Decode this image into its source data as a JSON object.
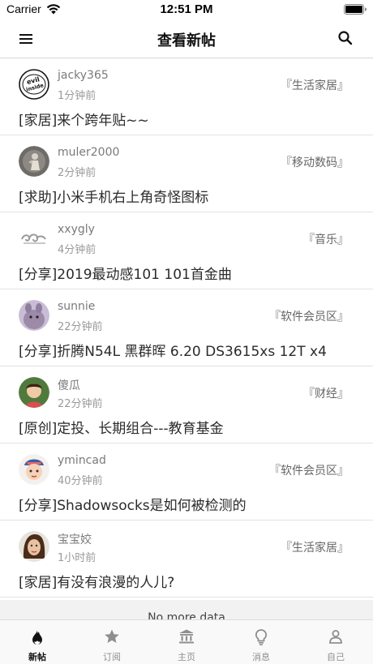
{
  "status_bar": {
    "carrier": "Carrier",
    "time": "12:51 PM"
  },
  "nav": {
    "title": "查看新帖"
  },
  "posts": [
    {
      "username": "jacky365",
      "time": "1分钟前",
      "forum": "『生活家居』",
      "title": "[家居]来个跨年贴~~",
      "avatar": "evil-inside-logo"
    },
    {
      "username": "muler2000",
      "time": "2分钟前",
      "forum": "『移动数码』",
      "title": "[求助]小米手机右上角奇怪图标",
      "avatar": "photo-figure"
    },
    {
      "username": "xxygly",
      "time": "4分钟前",
      "forum": "『音乐』",
      "title": "[分享]2019最动感101 101首金曲",
      "avatar": "cloud-swirl"
    },
    {
      "username": "sunnie",
      "time": "22分钟前",
      "forum": "『软件会员区』",
      "title": "[分享]折腾N54L 黑群晖 6.20 DS3615xs 12T x4",
      "avatar": "purple-plush"
    },
    {
      "username": "傻瓜",
      "time": "22分钟前",
      "forum": "『财经』",
      "title": "[原创]定投、长期组合---教育基金",
      "avatar": "child-photo"
    },
    {
      "username": "ymincad",
      "time": "40分钟前",
      "forum": "『软件会员区』",
      "title": "[分享]Shadowsocks是如何被检测的",
      "avatar": "baby-photo"
    },
    {
      "username": "宝宝姣",
      "time": "1小时前",
      "forum": "『生活家居』",
      "title": "[家居]有没有浪漫的人儿?",
      "avatar": "woman-portrait"
    }
  ],
  "list_footer": "No more data",
  "tabs": [
    {
      "label": "新帖",
      "icon": "flame-icon",
      "active": true
    },
    {
      "label": "订阅",
      "icon": "star-icon",
      "active": false
    },
    {
      "label": "主页",
      "icon": "building-icon",
      "active": false
    },
    {
      "label": "消息",
      "icon": "lightbulb-icon",
      "active": false
    },
    {
      "label": "自己",
      "icon": "person-icon",
      "active": false
    }
  ],
  "colors": {
    "accent": "#111111",
    "inactive": "#8e8e8e",
    "divider": "#e2e2e2"
  }
}
